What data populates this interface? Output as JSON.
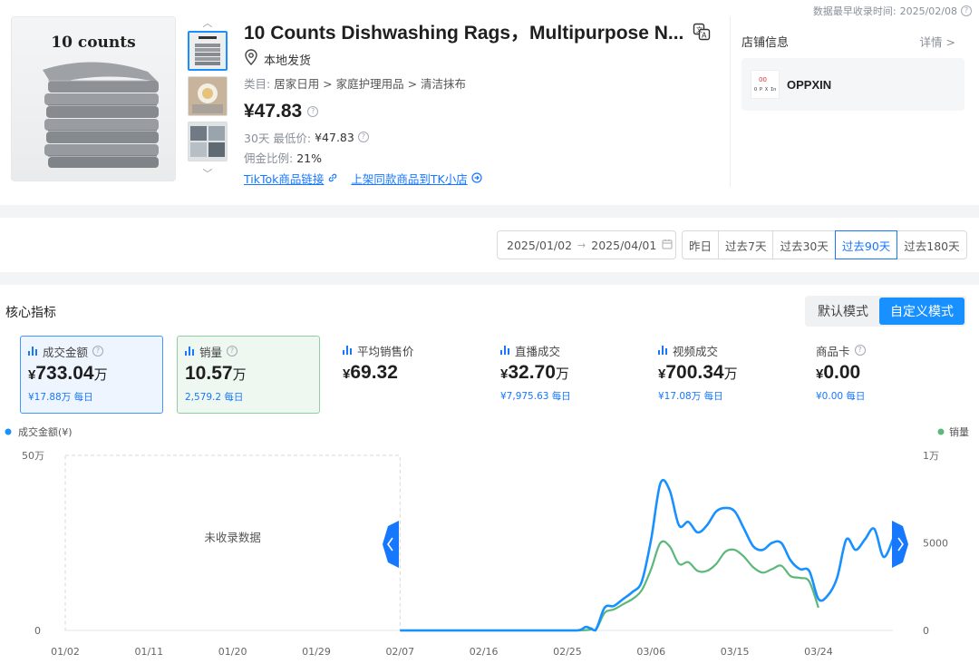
{
  "header": {
    "earliest_label": "数据最早收录时间:",
    "earliest_date": "2025/02/08"
  },
  "product": {
    "image_caption": "10 counts",
    "title": "10 Counts Dishwashing Rags，Multipurpose N...",
    "location": "本地发货",
    "category_label": "类目:",
    "category_path": "居家日用 > 家庭护理用品 > 清洁抹布",
    "price": "¥47.83",
    "low_label": "30天 最低价:",
    "low_value": "¥47.83",
    "commission_label": "佣金比例:",
    "commission_value": "21%",
    "link1": "TikTok商品链接",
    "link2": "上架同款商品到TK小店"
  },
  "store": {
    "label": "店铺信息",
    "detail": "详情 >",
    "name": "OPPXIN"
  },
  "filters": {
    "date_start": "2025/01/02",
    "date_end": "2025/04/01",
    "periods": [
      "昨日",
      "过去7天",
      "过去30天",
      "过去90天",
      "过去180天"
    ],
    "active_period": "过去90天"
  },
  "core": {
    "title": "核心指标",
    "modes": [
      "默认模式",
      "自定义模式"
    ],
    "active_mode": "自定义模式",
    "metrics": [
      {
        "label": "成交金额",
        "currency": "¥",
        "value": "733.04",
        "unit": "万",
        "sub": "¥17.88万 每日",
        "help": true,
        "selected": "blue"
      },
      {
        "label": "销量",
        "currency": "",
        "value": "10.57",
        "unit": "万",
        "sub": "2,579.2 每日",
        "help": true,
        "selected": "green"
      },
      {
        "label": "平均销售价",
        "currency": "¥",
        "value": "69.32",
        "unit": "",
        "sub": "",
        "help": false,
        "selected": ""
      },
      {
        "label": "直播成交",
        "currency": "¥",
        "value": "32.70",
        "unit": "万",
        "sub": "¥7,975.63 每日",
        "help": false,
        "selected": ""
      },
      {
        "label": "视频成交",
        "currency": "¥",
        "value": "700.34",
        "unit": "万",
        "sub": "¥17.08万 每日",
        "help": false,
        "selected": ""
      },
      {
        "label": "商品卡",
        "currency": "¥",
        "value": "0.00",
        "unit": "",
        "sub": "¥0.00 每日",
        "help": true,
        "selected": ""
      }
    ]
  },
  "colors": {
    "primary": "#1677ff",
    "series_amount": "#1890ff",
    "series_sales": "#5cb87a",
    "no_data_bg": "#ffffff"
  },
  "chart_data": {
    "type": "line",
    "left_legend": "成交金额(¥)",
    "right_legend": "销量",
    "no_data_text": "未收录数据",
    "no_data_range": [
      "01/02",
      "02/07"
    ],
    "x_ticks": [
      "01/02",
      "01/11",
      "01/20",
      "01/29",
      "02/07",
      "02/16",
      "02/25",
      "03/06",
      "03/15",
      "03/24"
    ],
    "y_left_ticks": [
      "0",
      "50万"
    ],
    "y_right_ticks": [
      "0",
      "5000",
      "1万"
    ],
    "ylim_left": [
      0,
      500000
    ],
    "ylim_right": [
      0,
      10000
    ],
    "series": [
      {
        "name": "成交金额(¥)",
        "axis": "left",
        "points": [
          [
            "02/07",
            0
          ],
          [
            "02/12",
            0
          ],
          [
            "02/17",
            0
          ],
          [
            "02/22",
            0
          ],
          [
            "02/26",
            0
          ],
          [
            "02/27",
            10000
          ],
          [
            "02/28",
            0
          ],
          [
            "03/01",
            65000
          ],
          [
            "03/02",
            70000
          ],
          [
            "03/03",
            90000
          ],
          [
            "03/04",
            110000
          ],
          [
            "03/05",
            140000
          ],
          [
            "03/06",
            260000
          ],
          [
            "03/07",
            420000
          ],
          [
            "03/08",
            400000
          ],
          [
            "03/09",
            300000
          ],
          [
            "03/10",
            310000
          ],
          [
            "03/11",
            280000
          ],
          [
            "03/12",
            300000
          ],
          [
            "03/13",
            340000
          ],
          [
            "03/14",
            350000
          ],
          [
            "03/15",
            340000
          ],
          [
            "03/16",
            290000
          ],
          [
            "03/17",
            240000
          ],
          [
            "03/18",
            230000
          ],
          [
            "03/19",
            250000
          ],
          [
            "03/20",
            250000
          ],
          [
            "03/21",
            200000
          ],
          [
            "03/22",
            175000
          ],
          [
            "03/23",
            170000
          ],
          [
            "03/24",
            90000
          ],
          [
            "03/25",
            100000
          ],
          [
            "03/26",
            150000
          ],
          [
            "03/27",
            260000
          ],
          [
            "03/28",
            230000
          ],
          [
            "03/29",
            260000
          ],
          [
            "03/30",
            290000
          ],
          [
            "03/31",
            210000
          ],
          [
            "04/01",
            260000
          ]
        ]
      },
      {
        "name": "销量",
        "axis": "right",
        "points": [
          [
            "02/07",
            0
          ],
          [
            "02/26",
            0
          ],
          [
            "02/27",
            200
          ],
          [
            "02/28",
            0
          ],
          [
            "03/01",
            1000
          ],
          [
            "03/02",
            1200
          ],
          [
            "03/03",
            1500
          ],
          [
            "03/04",
            1800
          ],
          [
            "03/05",
            2300
          ],
          [
            "03/06",
            3500
          ],
          [
            "03/07",
            5000
          ],
          [
            "03/08",
            4800
          ],
          [
            "03/09",
            3800
          ],
          [
            "03/10",
            3900
          ],
          [
            "03/11",
            3400
          ],
          [
            "03/12",
            3400
          ],
          [
            "03/13",
            3800
          ],
          [
            "03/14",
            4500
          ],
          [
            "03/15",
            4600
          ],
          [
            "03/16",
            4200
          ],
          [
            "03/17",
            3600
          ],
          [
            "03/18",
            3300
          ],
          [
            "03/19",
            3500
          ],
          [
            "03/20",
            3700
          ],
          [
            "03/21",
            3100
          ],
          [
            "03/22",
            3000
          ],
          [
            "03/23",
            2800
          ],
          [
            "03/24",
            1300
          ]
        ]
      }
    ]
  }
}
